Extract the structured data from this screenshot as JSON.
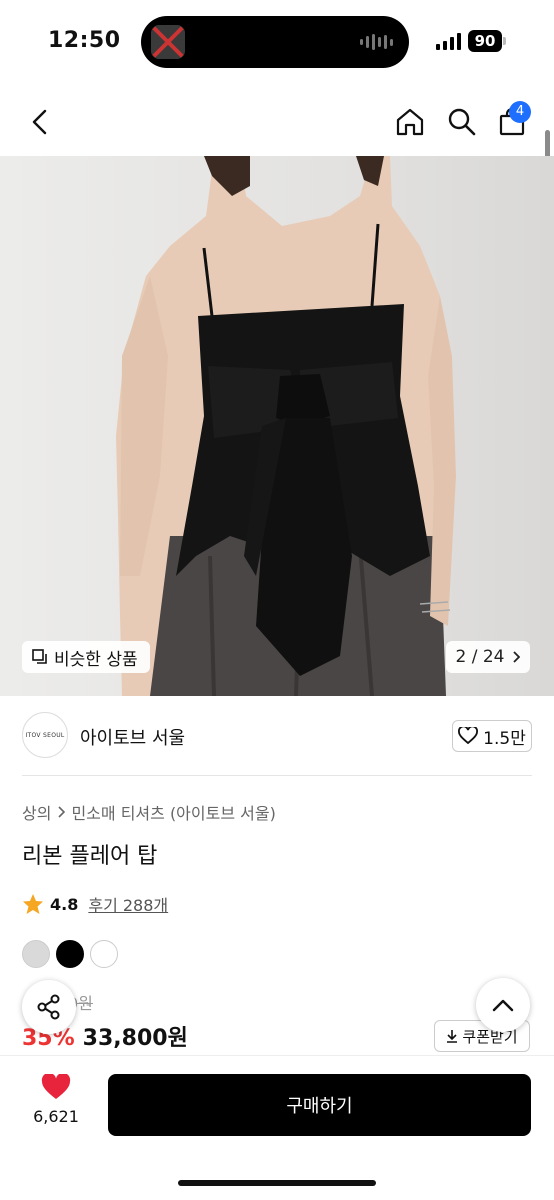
{
  "status_bar": {
    "time": "12:50",
    "battery": "90"
  },
  "nav": {
    "cart_count": "4",
    "icons": [
      "chevron-left-icon",
      "home-icon",
      "search-icon",
      "shopping-bag-icon"
    ]
  },
  "gallery": {
    "similar_label": "비슷한 상품",
    "page_indicator": "2 / 24",
    "image_description_icon": "product-photo"
  },
  "brand": {
    "logo_text": "ITOV SEOUL",
    "name": "아이토브 서울",
    "likes": "1.5만"
  },
  "breadcrumb": {
    "category": "상의",
    "subcategory": "민소매 티셔츠 (아이토브 서울)"
  },
  "product": {
    "title": "리본 플레어 탑",
    "rating": "4.8",
    "reviews": "후기 288개",
    "swatches": [
      "#d9d9d9",
      "#000000",
      "#ffffff"
    ],
    "original_price_fragment": "0원",
    "discount": "35%",
    "sale_price": "33,800원",
    "coupon_label": "쿠폰받기"
  },
  "bottom_bar": {
    "wish_count": "6,621",
    "buy_label": "구매하기"
  },
  "colors": {
    "accent": "#1f6fff",
    "discount": "#e33333",
    "heart": "#e8243c",
    "buy_button": "#000000"
  }
}
